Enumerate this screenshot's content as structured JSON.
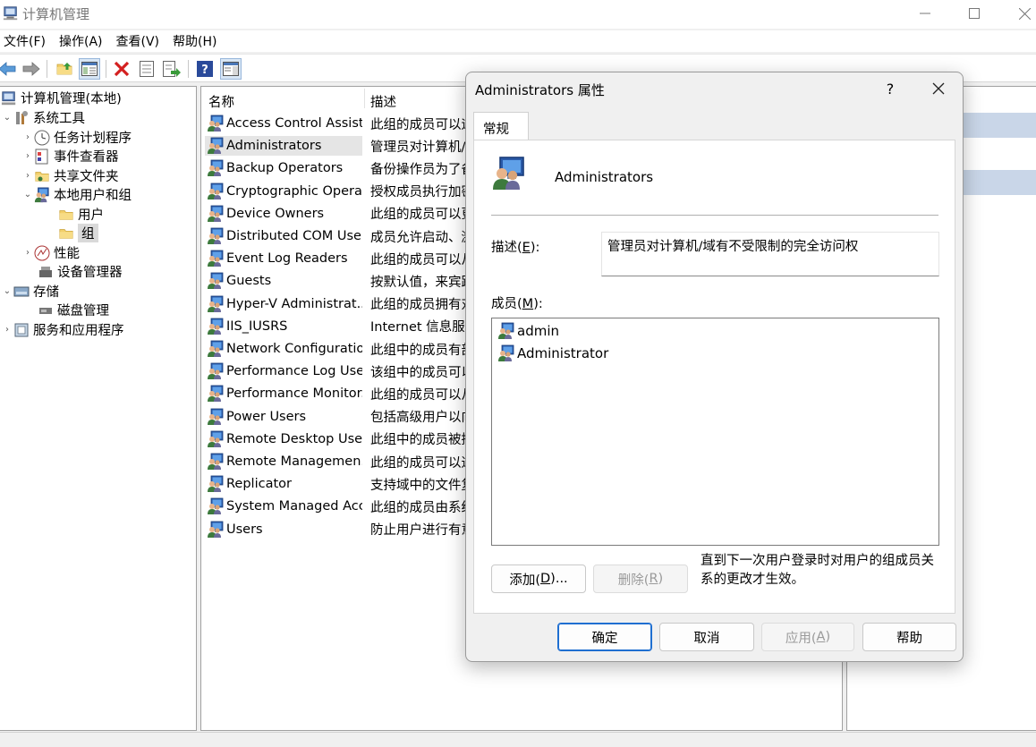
{
  "window": {
    "title": "计算机管理"
  },
  "menu": [
    "文件(F)",
    "操作(A)",
    "查看(V)",
    "帮助(H)"
  ],
  "tree": {
    "root": "计算机管理(本地)",
    "system_tools": "系统工具",
    "task_scheduler": "任务计划程序",
    "event_viewer": "事件查看器",
    "shared_folders": "共享文件夹",
    "local_users_groups": "本地用户和组",
    "users": "用户",
    "groups": "组",
    "performance": "性能",
    "device_manager": "设备管理器",
    "storage": "存储",
    "disk_management": "磁盘管理",
    "services_apps": "服务和应用程序"
  },
  "list": {
    "col_name": "名称",
    "col_desc": "描述",
    "rows": [
      {
        "name": "Access Control Assist...",
        "desc": "此组的成员可以远"
      },
      {
        "name": "Administrators",
        "desc": "管理员对计算机/"
      },
      {
        "name": "Backup Operators",
        "desc": "备份操作员为了备"
      },
      {
        "name": "Cryptographic Operat...",
        "desc": "授权成员执行加密"
      },
      {
        "name": "Device Owners",
        "desc": "此组的成员可以更"
      },
      {
        "name": "Distributed COM Users",
        "desc": "成员允许启动、激"
      },
      {
        "name": "Event Log Readers",
        "desc": "此组的成员可以从"
      },
      {
        "name": "Guests",
        "desc": "按默认值，来宾跟"
      },
      {
        "name": "Hyper-V Administrat...",
        "desc": "此组的成员拥有对"
      },
      {
        "name": "IIS_IUSRS",
        "desc": "Internet 信息服务"
      },
      {
        "name": "Network Configuratio...",
        "desc": "此组中的成员有部"
      },
      {
        "name": "Performance Log Users",
        "desc": "该组中的成员可以"
      },
      {
        "name": "Performance Monitor...",
        "desc": "此组的成员可以从"
      },
      {
        "name": "Power Users",
        "desc": "包括高级用户以向"
      },
      {
        "name": "Remote Desktop Users",
        "desc": "此组中的成员被授"
      },
      {
        "name": "Remote Managemen...",
        "desc": "此组的成员可以通"
      },
      {
        "name": "Replicator",
        "desc": "支持域中的文件复"
      },
      {
        "name": "System Managed Acc...",
        "desc": "此组的成员由系统"
      },
      {
        "name": "Users",
        "desc": "防止用户进行有意"
      }
    ]
  },
  "dialog": {
    "title": "Administrators 属性",
    "help_glyph": "?",
    "tab": "常规",
    "group_name": "Administrators",
    "desc_label_pre": "描述(",
    "desc_label_key": "E",
    "desc_label_post": "):",
    "description": "管理员对计算机/域有不受限制的完全访问权",
    "members_label_pre": "成员(",
    "members_label_key": "M",
    "members_label_post": "):",
    "members": [
      "admin",
      "Administrator"
    ],
    "add_pre": "添加(",
    "add_key": "D",
    "add_post": ")...",
    "remove_pre": "删除(",
    "remove_key": "R",
    "remove_post": ")",
    "note": "直到下一次用户登录时对用户的组成员关系的更改才生效。",
    "ok": "确定",
    "cancel": "取消",
    "apply_pre": "应用(",
    "apply_key": "A",
    "apply_post": ")",
    "help": "帮助"
  }
}
